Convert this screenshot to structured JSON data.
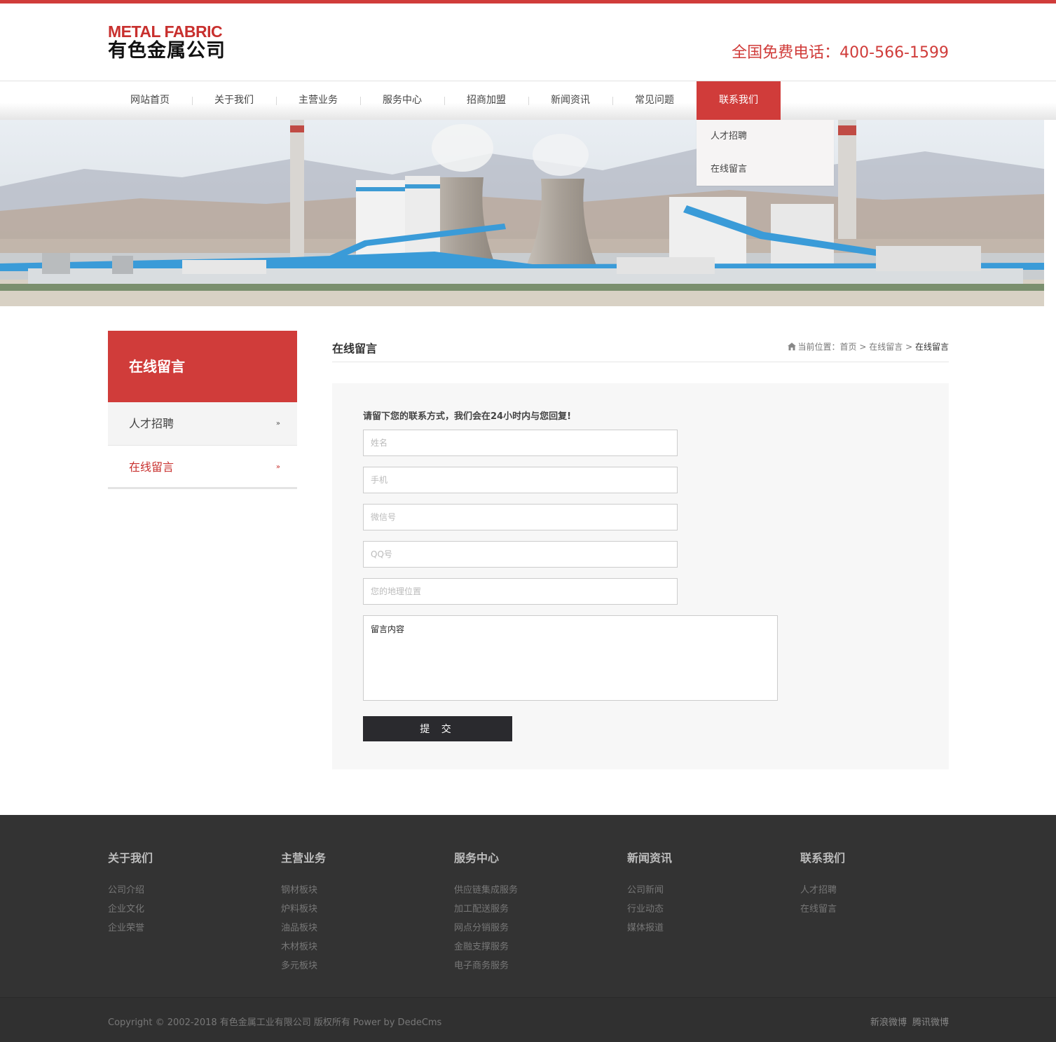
{
  "header": {
    "logo_en": "METAL FABRIC",
    "logo_cn": "有色金属公司",
    "hotline": "全国免费电话：400-566-1599"
  },
  "nav": {
    "items": [
      "网站首页",
      "关于我们",
      "主营业务",
      "服务中心",
      "招商加盟",
      "新闻资讯",
      "常见问题",
      "联系我们"
    ],
    "active_index": 7,
    "dropdown": [
      "人才招聘",
      "在线留言"
    ]
  },
  "sidebar": {
    "title": "在线留言",
    "items": [
      {
        "label": "人才招聘",
        "arrow": "»"
      },
      {
        "label": "在线留言",
        "arrow": "»"
      }
    ],
    "current_index": 1
  },
  "content": {
    "title": "在线留言",
    "breadcrumb": {
      "prefix": "当前位置：",
      "home": "首页",
      "sep": ">",
      "section": "在线留言",
      "current": "在线留言"
    },
    "form": {
      "tip": "请留下您的联系方式，我们会在24小时内与您回复!",
      "name_placeholder": "姓名",
      "phone_placeholder": "手机",
      "wechat_placeholder": "微信号",
      "qq_placeholder": "QQ号",
      "location_placeholder": "您的地理位置",
      "message_value": "留言内容",
      "submit_label": "提 交"
    }
  },
  "footer": {
    "columns": [
      {
        "title": "关于我们",
        "links": [
          "公司介绍",
          "企业文化",
          "企业荣誉"
        ]
      },
      {
        "title": "主营业务",
        "links": [
          "钢材板块",
          "炉料板块",
          "油品板块",
          "木材板块",
          "多元板块"
        ]
      },
      {
        "title": "服务中心",
        "links": [
          "供应链集成服务",
          "加工配送服务",
          "网点分销服务",
          "金融支撑服务",
          "电子商务服务"
        ]
      },
      {
        "title": "新闻资讯",
        "links": [
          "公司新闻",
          "行业动态",
          "媒体报道"
        ]
      },
      {
        "title": "联系我们",
        "links": [
          "人才招聘",
          "在线留言"
        ]
      }
    ],
    "copyright": "Copyright © 2002-2018 有色金属工业有限公司 版权所有 Power by DedeCms",
    "social": [
      "新浪微博",
      "腾讯微博"
    ]
  },
  "colors": {
    "accent": "#d03c3a",
    "footer_bg": "#333333",
    "submit_bg": "#2a2a2e"
  }
}
